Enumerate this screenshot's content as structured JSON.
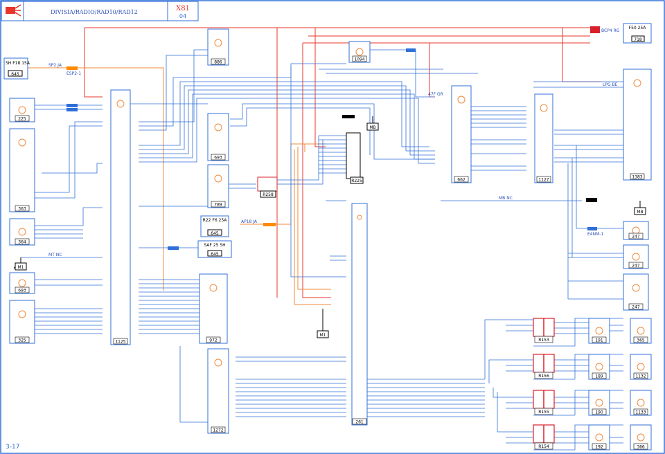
{
  "header": {
    "title": "DIVISIA/RADIO/RAD10/RAD12",
    "code": "X81",
    "revision": "04",
    "page_ref": "3-17"
  },
  "colors": {
    "frame": "#2f6fd8",
    "wire_orange": "#f08a3a",
    "wire_red": "#e8352a",
    "wire_blue": "#2f6fd8",
    "text": "#2a4fb8",
    "connector_red": "#d8202a",
    "connector_black": "#000000",
    "highlight_orange": "#ff8a00"
  },
  "fuses": [
    {
      "id": "f645a",
      "label": "SH F18 15A",
      "num": "645"
    },
    {
      "id": "f645b",
      "label": "R22 F6 25A",
      "num": "645"
    },
    {
      "id": "f645c",
      "label": "SAF 25 SH",
      "num": "645"
    },
    {
      "id": "f718",
      "label": "F50 25A",
      "num": "718"
    }
  ],
  "components": [
    {
      "id": "c886",
      "num": "886",
      "icon": "antenna-icon"
    },
    {
      "id": "c1094",
      "num": "1094",
      "icon": "light-icon"
    },
    {
      "id": "c225",
      "num": "225",
      "icon": "radio-icon"
    },
    {
      "id": "c363",
      "num": "363",
      "icon": "control-icon"
    },
    {
      "id": "c364",
      "num": "364",
      "icon": "speaker-icon"
    },
    {
      "id": "c693a",
      "num": "693",
      "icon": "speaker-icon"
    },
    {
      "id": "c325",
      "num": "325",
      "icon": "phone-icon"
    },
    {
      "id": "c1125",
      "num": "1125",
      "icon": "module-icon"
    },
    {
      "id": "c693b",
      "num": "693",
      "icon": "speaker-icon"
    },
    {
      "id": "c789",
      "num": "789",
      "icon": "wiper-icon"
    },
    {
      "id": "c972",
      "num": "972",
      "icon": "display-icon"
    },
    {
      "id": "c1272",
      "num": "1272",
      "icon": "cd-icon"
    },
    {
      "id": "c261",
      "num": "261",
      "icon": "radio-icon"
    },
    {
      "id": "c662",
      "num": "662",
      "icon": "module-icon"
    },
    {
      "id": "c1127",
      "num": "1127",
      "icon": "switch-icon"
    },
    {
      "id": "c1383",
      "num": "1383",
      "icon": "adjust-icon"
    },
    {
      "id": "c247a",
      "num": "247",
      "icon": "note-icon"
    },
    {
      "id": "c247b",
      "num": "247",
      "icon": "note-icon"
    },
    {
      "id": "c247c",
      "num": "247",
      "icon": "note-icon"
    },
    {
      "id": "c191",
      "num": "191",
      "icon": "speaker-icon"
    },
    {
      "id": "c365",
      "num": "365",
      "icon": "speaker-icon"
    },
    {
      "id": "c189",
      "num": "189",
      "icon": "speaker-icon"
    },
    {
      "id": "c1132",
      "num": "1132",
      "icon": "speaker-icon"
    },
    {
      "id": "c190",
      "num": "190",
      "icon": "speaker-icon"
    },
    {
      "id": "c1133",
      "num": "1133",
      "icon": "speaker-icon"
    },
    {
      "id": "c192",
      "num": "192",
      "icon": "speaker-icon"
    },
    {
      "id": "c366",
      "num": "366",
      "icon": "speaker-icon"
    }
  ],
  "connectors": [
    {
      "id": "r225",
      "label": "R225"
    },
    {
      "id": "r258",
      "label": "R258"
    },
    {
      "id": "r153",
      "label": "R153"
    },
    {
      "id": "r156",
      "label": "R156"
    },
    {
      "id": "r155",
      "label": "R155"
    },
    {
      "id": "r154",
      "label": "R154"
    }
  ],
  "grounds": [
    {
      "id": "g1",
      "label": "M1"
    },
    {
      "id": "g2",
      "label": "M1"
    },
    {
      "id": "g3",
      "label": "MB"
    },
    {
      "id": "g4",
      "label": "MB"
    }
  ],
  "wire_labels": {
    "sp2_ja": "SP2 JA",
    "ep2": "ESP2-1",
    "bcp4_rg": "BCP4 RG",
    "lpg_be": "LPG BE",
    "mb_nc": "MB NC",
    "ap18_ja": "AP18 JA",
    "g47f_gr": "47F GR",
    "mt_nc": "MT NC",
    "e4m": "E4NM-1"
  }
}
